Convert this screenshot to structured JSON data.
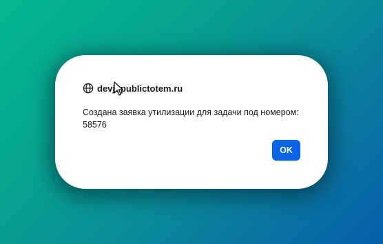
{
  "dialog": {
    "origin": "devjf.publictotem.ru",
    "origin_icon": "globe-icon",
    "message_line1": "Создана заявка утилизации для задачи под номером:",
    "message_line2": "58576",
    "ok_label": "OK"
  },
  "colors": {
    "button": "#0b63e8",
    "background_start": "#05b890",
    "background_end": "#0660a8"
  },
  "cursor": "arrow-cursor-icon"
}
